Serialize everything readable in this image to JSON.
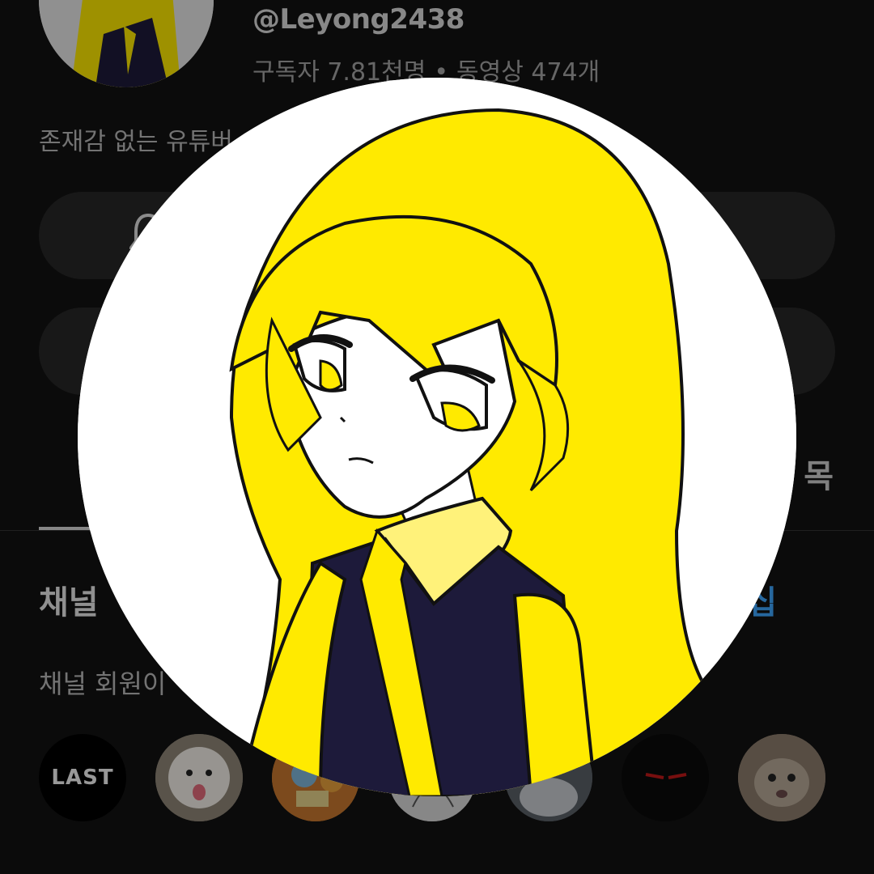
{
  "channel": {
    "handle": "@Leyong2438",
    "subscribers": "구독자 7.81천명",
    "separator": "•",
    "videos": "동영상 474개",
    "description": "존재감 없는 유튜버"
  },
  "tabs": {
    "right_tab_label": "목"
  },
  "members_section": {
    "title": "채널",
    "link": "십",
    "subtitle": "채널 회원이",
    "avatars": [
      {
        "label": "LAST"
      },
      {
        "label": ""
      },
      {
        "label": ""
      },
      {
        "label": ""
      },
      {
        "label": ""
      },
      {
        "label": ""
      },
      {
        "label": ""
      }
    ]
  },
  "colors": {
    "hair_yellow": "#ffea00",
    "vest_navy": "#1d1a3a",
    "collar_yellow": "#fff27a",
    "link_blue": "#3ea6ff"
  }
}
